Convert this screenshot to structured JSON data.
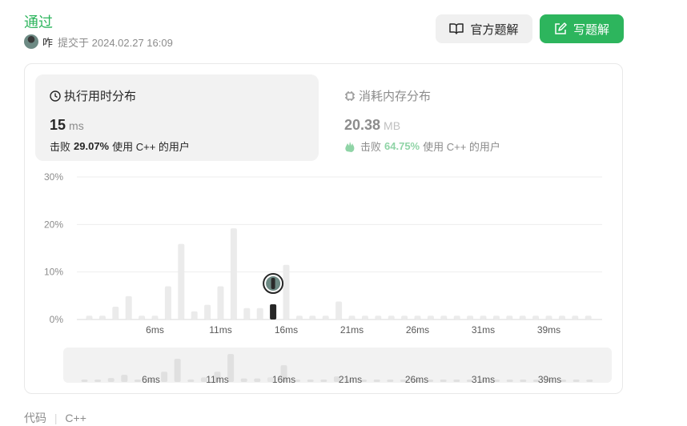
{
  "header": {
    "status": "通过",
    "username": "咋",
    "submitted_text": "提交于 2024.02.27 16:09",
    "official_solution_label": "官方题解",
    "write_solution_label": "写题解"
  },
  "runtime": {
    "title": "执行用时分布",
    "value": "15",
    "unit": "ms",
    "beats_prefix": "击败",
    "beats_percent": "29.07%",
    "beats_suffix": "使用 C++ 的用户"
  },
  "memory": {
    "title": "消耗内存分布",
    "value": "20.38",
    "unit": "MB",
    "beats_prefix": "击败",
    "beats_percent": "64.75%",
    "beats_suffix": "使用 C++ 的用户"
  },
  "colors": {
    "accent": "#2db55d",
    "bar": "#ebebeb",
    "highlight_bar": "#262626"
  },
  "chart_data": {
    "type": "bar",
    "y_ticks": [
      "30%",
      "20%",
      "10%",
      "0%"
    ],
    "ylim": [
      0,
      30
    ],
    "x_tick_labels": [
      "6ms",
      "11ms",
      "16ms",
      "21ms",
      "26ms",
      "31ms",
      "39ms"
    ],
    "values": [
      0.8,
      0.8,
      2.7,
      4.9,
      0.8,
      0.8,
      7.0,
      15.9,
      1.7,
      3.1,
      7.0,
      19.2,
      2.4,
      2.4,
      3.2,
      11.5,
      0.8,
      0.8,
      0.8,
      3.8,
      0.8,
      0.8,
      0.8,
      0.8,
      0.8,
      0.8,
      0.8,
      0.8,
      0.8,
      0.8,
      0.8,
      0.8,
      0.8,
      0.8,
      0.8,
      0.8,
      0.8,
      0.8,
      0.8
    ],
    "highlight_index": 14,
    "grid": true
  },
  "code_section": {
    "label": "代码",
    "language": "C++"
  }
}
